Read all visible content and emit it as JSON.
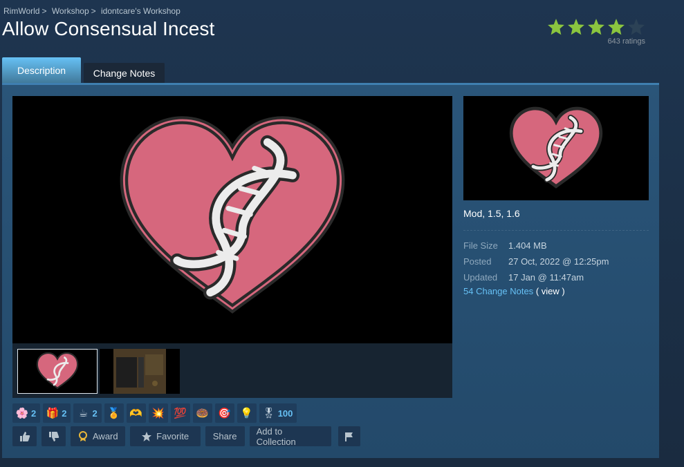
{
  "breadcrumb": {
    "items": [
      "RimWorld",
      "Workshop",
      "idontcare's Workshop"
    ],
    "separator": ">"
  },
  "title": "Allow Consensual Incest",
  "rating": {
    "stars_filled": 4,
    "stars_total": 5,
    "count_text": "643 ratings",
    "filled_color": "#8bc53f",
    "empty_color": "#2c4256"
  },
  "tabs": [
    {
      "label": "Description",
      "active": true
    },
    {
      "label": "Change Notes",
      "active": false
    }
  ],
  "media": {
    "main_image": "heart-dna-logo",
    "thumbnails": [
      "heart-dna-logo",
      "gameplay-screenshot"
    ],
    "selected_thumbnail": 0
  },
  "sidebar": {
    "tags": "Mod, 1.5, 1.6",
    "stats": [
      {
        "label": "File Size",
        "value": "1.404 MB"
      },
      {
        "label": "Posted",
        "value": "27 Oct, 2022 @ 12:25pm"
      },
      {
        "label": "Updated",
        "value": "17 Jan @ 11:47am"
      }
    ],
    "change_notes_link": "54 Change Notes",
    "view_link": "( view )"
  },
  "awards": [
    {
      "icon": "flower-award",
      "emoji": "🌸",
      "count": "2"
    },
    {
      "icon": "gift-award",
      "emoji": "🎁",
      "count": "2"
    },
    {
      "icon": "coffee-award",
      "emoji": "☕",
      "count": "2"
    },
    {
      "icon": "medal-award",
      "emoji": "🏅",
      "count": ""
    },
    {
      "icon": "heart-hands-award",
      "emoji": "🫶",
      "count": ""
    },
    {
      "icon": "explosion-award",
      "emoji": "💥",
      "count": ""
    },
    {
      "icon": "hundred-award",
      "emoji": "💯",
      "count": ""
    },
    {
      "icon": "donut-award",
      "emoji": "🍩",
      "count": ""
    },
    {
      "icon": "target-award",
      "emoji": "🎯",
      "count": ""
    },
    {
      "icon": "lightbulb-award",
      "emoji": "💡",
      "count": ""
    },
    {
      "icon": "ribbon-award",
      "emoji": "🎖",
      "count": "100"
    }
  ],
  "actions": {
    "award_label": "Award",
    "favorite_label": "Favorite",
    "share_label": "Share",
    "collection_label": "Add to Collection"
  },
  "colors": {
    "accent": "#66c0f4",
    "panel": "#23496a",
    "heart": "#d6677d"
  }
}
